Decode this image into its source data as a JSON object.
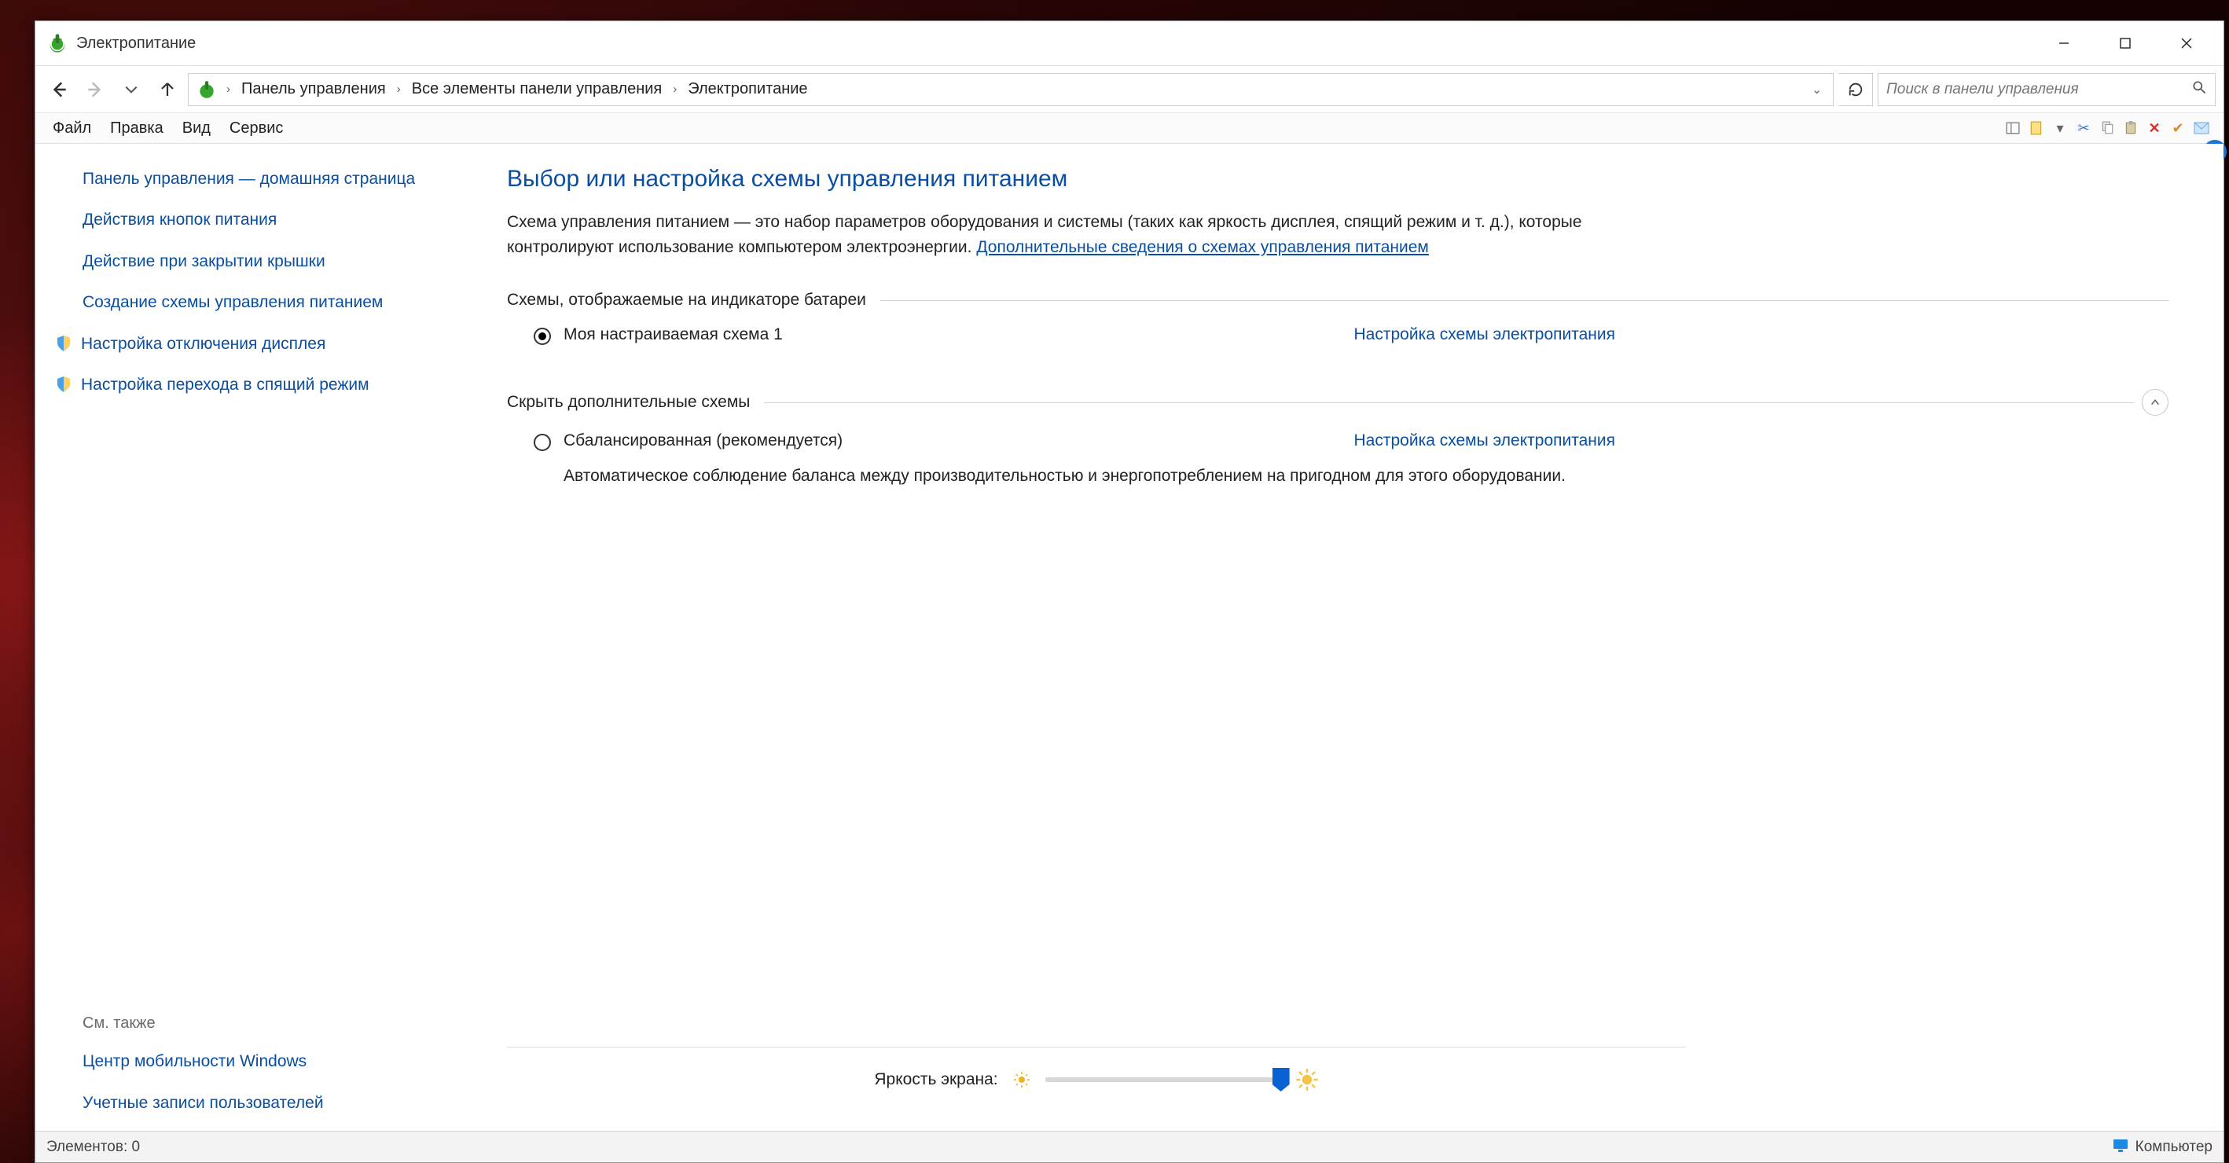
{
  "window": {
    "title": "Электропитание"
  },
  "breadcrumbs": {
    "items": [
      "Панель управления",
      "Все элементы панели управления",
      "Электропитание"
    ]
  },
  "search": {
    "placeholder": "Поиск в панели управления"
  },
  "menubar": {
    "file": "Файл",
    "edit": "Правка",
    "view": "Вид",
    "service": "Сервис"
  },
  "sidebar": {
    "links": [
      "Панель управления — домашняя страница",
      "Действия кнопок питания",
      "Действие при закрытии крышки",
      "Создание схемы управления питанием",
      "Настройка отключения дисплея",
      "Настройка перехода в спящий режим"
    ],
    "see_also_label": "См. также",
    "see_also_links": [
      "Центр мобильности Windows",
      "Учетные записи пользователей"
    ]
  },
  "content": {
    "title": "Выбор или настройка схемы управления питанием",
    "description": "Схема управления питанием — это набор параметров оборудования и системы (таких как яркость дисплея, спящий режим и т. д.), которые контролируют использование компьютером электроэнергии.",
    "more_info_link": "Дополнительные сведения о схемах управления питанием",
    "section1_label": "Схемы, отображаемые на индикаторе батареи",
    "plan1": {
      "label": "Моя настраиваемая схема 1",
      "link": "Настройка схемы электропитания",
      "selected": true
    },
    "section2_label": "Скрыть дополнительные схемы",
    "plan2": {
      "label": "Сбалансированная (рекомендуется)",
      "link": "Настройка схемы электропитания",
      "desc": "Автоматическое соблюдение баланса между производительностью и энергопотреблением на пригодном для этого оборудовании.",
      "selected": false
    },
    "brightness_label": "Яркость экрана:"
  },
  "statusbar": {
    "left": "Элементов: 0",
    "right": "Компьютер"
  }
}
